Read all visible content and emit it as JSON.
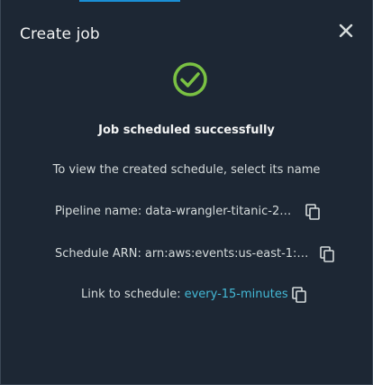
{
  "colors": {
    "background": "#1d2734",
    "accent": "#1a8fd6",
    "success": "#7ac143",
    "link": "#44b9d6"
  },
  "modal": {
    "title": "Create job",
    "close_icon": "close-icon"
  },
  "status": {
    "icon": "check-circle-icon",
    "title": "Job scheduled successfully",
    "instruction": "To view the created schedule, select its name"
  },
  "details": {
    "pipeline": {
      "label": "Pipeline name:",
      "value": "data-wrangler-titanic-202...",
      "copy_icon": "copy-icon"
    },
    "schedule_arn": {
      "label": "Schedule ARN:",
      "value": "arn:aws:events:us-east-1:4...",
      "copy_icon": "copy-icon"
    },
    "schedule_link": {
      "label": "Link to schedule:",
      "link_text": "every-15-minutes",
      "copy_icon": "copy-icon"
    }
  }
}
